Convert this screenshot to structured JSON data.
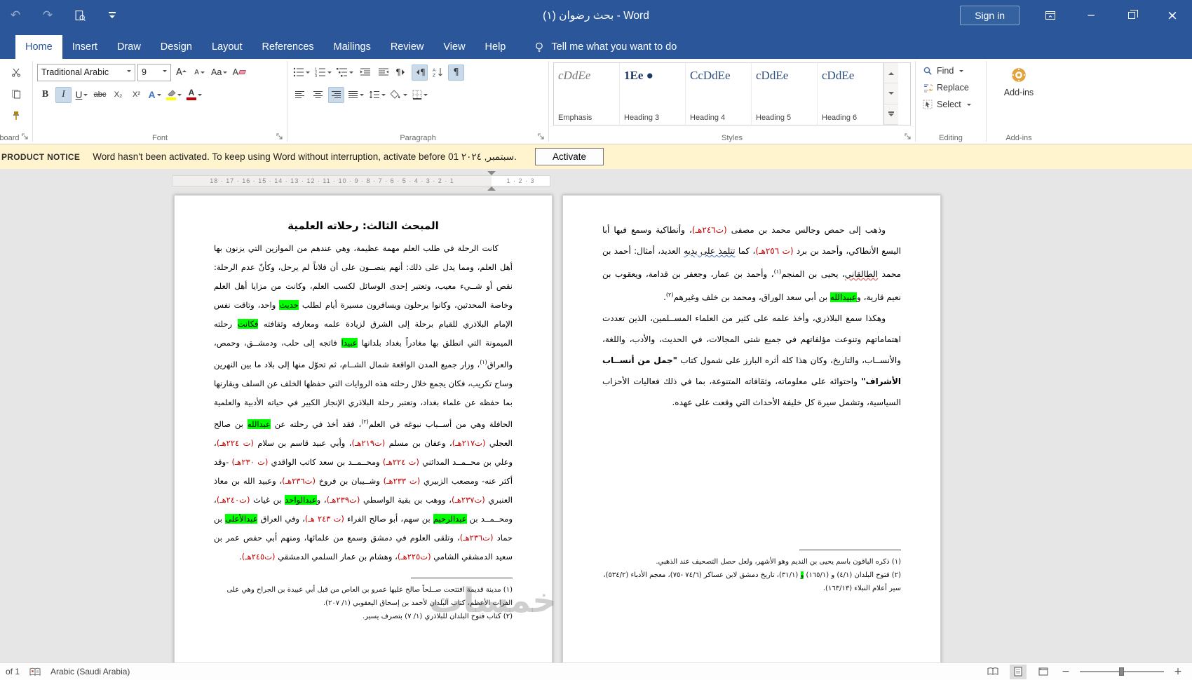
{
  "titlebar": {
    "title": "بحث رضوان (١)  -  Word",
    "sign_in": "Sign in"
  },
  "tabs": [
    {
      "label": "Home"
    },
    {
      "label": "Insert"
    },
    {
      "label": "Draw"
    },
    {
      "label": "Design"
    },
    {
      "label": "Layout"
    },
    {
      "label": "References"
    },
    {
      "label": "Mailings"
    },
    {
      "label": "Review"
    },
    {
      "label": "View"
    },
    {
      "label": "Help"
    }
  ],
  "tell_me": "Tell me what you want to do",
  "icons": {
    "undo": "↶",
    "redo": "↷",
    "minimize": "─",
    "close": "×",
    "pilcrow": "¶",
    "bold": "B",
    "italic": "I",
    "underline": "U",
    "strikethrough": "abc",
    "subscript": "X₂",
    "superscript": "X²",
    "grow_font": "A",
    "shrink_font": "A",
    "change_case": "Aa",
    "clear_formatting": "A",
    "text_effects": "A",
    "font_color": "A",
    "zoom_out": "−",
    "zoom_in": "+"
  },
  "ribbon": {
    "clipboard": {
      "group_label": "Clipboard"
    },
    "font": {
      "group_label": "Font",
      "font_name": "Traditional Arabic",
      "font_size": "9"
    },
    "paragraph": {
      "group_label": "Paragraph"
    },
    "styles": {
      "group_label": "Styles",
      "items": [
        {
          "preview": "cDdEe",
          "label": "Emphasis"
        },
        {
          "preview": "1Ee ●",
          "label": "Heading 3"
        },
        {
          "preview": "CcDdEe",
          "label": "Heading 4"
        },
        {
          "preview": "cDdEe",
          "label": "Heading 5"
        },
        {
          "preview": "cDdEe",
          "label": "Heading 6"
        }
      ]
    },
    "editing": {
      "group_label": "Editing",
      "find_label": "Find",
      "replace_label": "Replace",
      "select_label": "Select"
    },
    "addins": {
      "group_label": "Add-ins",
      "button_label": "Add-ins"
    }
  },
  "notice": {
    "label": "PRODUCT NOTICE",
    "message": "Word hasn't been activated. To keep using Word without interruption, activate before 01 سبتمبر, ٢٠٢٤.",
    "button": "Activate"
  },
  "ruler": {
    "outside_numbers": "18 · 17 · 16 · 15 · 14 · 13 · 12 · 11 · 10 · 9 · 8 · 7 · 6 · 5 · 4 · 3 · 2 · 1",
    "margin_numbers": "1 · 2 · 3"
  },
  "document": {
    "page_right": {
      "paragraphs": [
        [
          {
            "t": "وذهب إلى حمص وجالس محمد بن مصفى "
          },
          {
            "t": "(ت٢٤٦هـ)",
            "c": "red"
          },
          {
            "t": "، وأنطاكية وسمع فيها أبا اليسع الأنطاكي، وأحمد بن برد "
          },
          {
            "t": "(ت ٢٥٦هـ)",
            "c": "red"
          },
          {
            "t": "، كما "
          },
          {
            "t": "تتلمذ على يديه",
            "c": "sqb"
          },
          {
            "t": " العديد، أمثال: أحمد بن محمد "
          },
          {
            "t": "الطالقاني",
            "c": "sqr"
          },
          {
            "t": "، يحيى بن المنجم"
          },
          {
            "t": "(١)",
            "c": "sup"
          },
          {
            "t": "، وأحمد بن عمار، وجعفر بن قدامة، ويعقوب بن نعيم قارية، و"
          },
          {
            "t": "عبيدالله",
            "c": "hl"
          },
          {
            "t": " بن أبي سعد الوراق، ومحمد بن خلف وغيرهم"
          },
          {
            "t": "(٢)",
            "c": "sup"
          },
          {
            "t": "."
          }
        ],
        [
          {
            "t": "وهكذا سمع البلاذري، وأخذ علمه على كثير من العلماء المســلمين، الذين تعددت اهتماماتهم وتنوعت مؤلفاتهم في جميع شتى المجالات، في الحديث، والأدب، واللغة، والأنســاب، والتاريخ، وكان هذا كله أثره البارز على شمول كتاب "
          },
          {
            "t": "\"جمل من أنســاب الأشراف\"",
            "c": "b"
          },
          {
            "t": " واحتوائه على معلوماته، وثقافاته المتنوعة، بما في ذلك فعاليات الأحزاب السياسية، وتشمل سيرة كل خليفة الأحداث التي وقعت على عهده."
          }
        ]
      ],
      "footnotes": [
        [
          {
            "t": "(١) ذكره الباقون باسم يحيى بن النديم وهو الأشهر، ولعل حصل التصحيف عند الذهبي."
          }
        ],
        [
          {
            "t": "(٢) فتوح البلدان (٤/١) و (١٦٥/١) "
          },
          {
            "t": "و",
            "c": "hl"
          },
          {
            "t": " (٣١/١)، تاريخ دمشق لابن عساكر (٧٤/٦ -٧٥)، معجم الأدباء (٥٣٤/٢)، سير أعلام النبلاء (١٦٣/١٣)."
          }
        ]
      ]
    },
    "page_left": {
      "heading": "المبحث الثالث: رحلاته العلمية",
      "paragraphs": [
        [
          {
            "t": "كانت الرحلة في طلب العلم مهمة عظيمة، وهي عندهم من الموازين التي يزنون بها أهل العلم، ومما يدل على ذلك: أنهم ينصــون على أن فلاناً لم يرحل، وكأنّ عدم الرحلة: نقص أو شــيء معيب، وتعتبر إحدى الوسائل لكسب العلم، وكانت من مزايا أهل العلم وخاصة المحدثين، وكانوا يرحلون ويسافرون مسيرة أيام لطلب "
          },
          {
            "t": "حديث",
            "c": "hl"
          },
          {
            "t": " واحد، وتاقت نفس الإمام البلاذري للقيام برحلة إلى الشرق لزيادة علمه ومعارفه وثقافته "
          },
          {
            "t": "فكانت",
            "c": "hl"
          },
          {
            "t": " رحلته الميمونة التي انطلق بها مغادراً بغداد بلدانها "
          },
          {
            "t": "عبيدا",
            "c": "hl"
          },
          {
            "t": " فاتجه إلى حلب، ودمشــق، وحمص، والعراق"
          },
          {
            "t": "(١)",
            "c": "sup"
          },
          {
            "t": "، وزار جميع المدن الواقعة شمال الشــام، ثم تحوّل منها إلى بلاد ما بين النهرين وساح تكريب، فكان يجمع خلال رحلته هذه الروايات التي حفظها الخلف عن السلف ويقارنها بما حفظه عن علماء بغداد، وتعتبر رحلة البلاذري الإنجاز الكبير في حياته الأدبية والعلمية الحافلة وهي من أســباب نبوغه في العلم"
          },
          {
            "t": "(٢)",
            "c": "sup"
          },
          {
            "t": "، فقد أخذ في رحلته عن "
          },
          {
            "t": "عبدالله",
            "c": "hl"
          },
          {
            "t": " بن صالح العجلي "
          },
          {
            "t": "(ت٢١٧هـ)",
            "c": "red"
          },
          {
            "t": "، وعفان بن مسلم "
          },
          {
            "t": "(ت٢١٩هـ)",
            "c": "red"
          },
          {
            "t": "، وأبي عبيد قاسم بن سلام "
          },
          {
            "t": "(ت ٢٢٤هـ)",
            "c": "red"
          },
          {
            "t": "، وعلي بن محــمــد المدائني "
          },
          {
            "t": "(ت ٢٢٤هـ)",
            "c": "red"
          },
          {
            "t": " ومحــمــد بن سعد كاتب الواقدي "
          },
          {
            "t": "(ت ٢٣٠هـ)",
            "c": "red"
          },
          {
            "t": " -وقد أكثر عنه- ومصعب الزبيري "
          },
          {
            "t": "(ت ٢٣٣هـ)",
            "c": "red"
          },
          {
            "t": " وشــيبان بن فروخ "
          },
          {
            "t": "(ت٢٣٦هـ)",
            "c": "red"
          },
          {
            "t": "، وعبيد الله بن معاذ العنبري "
          },
          {
            "t": "(ت٢٣٧هـ)",
            "c": "red"
          },
          {
            "t": "، ووهب بن بقية الواسطي "
          },
          {
            "t": "(ت٢٣٩هـ)",
            "c": "red"
          },
          {
            "t": "، و"
          },
          {
            "t": "عبدالواحد",
            "c": "hl"
          },
          {
            "t": " بن غياث "
          },
          {
            "t": "(ت٢٤٠هـ)",
            "c": "red"
          },
          {
            "t": "، ومحــمــد بن "
          },
          {
            "t": "عبدالرحيم",
            "c": "hl"
          },
          {
            "t": " بن سهم، أبو صالح الفراء "
          },
          {
            "t": "(ت ٢٤٣ هـ)",
            "c": "red"
          },
          {
            "t": "، وفي العراق "
          },
          {
            "t": "عبدالأعلى",
            "c": "hl"
          },
          {
            "t": " بن حماد "
          },
          {
            "t": "(ت٢٣٦هـ)",
            "c": "red"
          },
          {
            "t": "، وتلقى العلوم في دمشق وسمع من علمائها، ومنهم أبي حفص عمر بن سعيد الدمشقي الشامي "
          },
          {
            "t": "(ت٢٢٥هـ)",
            "c": "red"
          },
          {
            "t": "، وهشام بن عمار السلمي الدمشقي "
          },
          {
            "t": "(ت٢٤٥هـ)",
            "c": "red"
          },
          {
            "t": "."
          }
        ]
      ],
      "footnotes": [
        [
          {
            "t": "(١) مدينة قديمة افتتحت صــلحاً صالح عليها عمرو بن العاص من قبل أبي عبيدة بن الجراح وهي على الفرات الأعظم، كتاب البلدان لأحمد بن إسحاق اليعقوبي (١/ ٢٠٧)."
          }
        ],
        [
          {
            "t": "(٢) كتاب فتوح البلدان للبلاذري (١/ ٧) بتصرف يسير."
          }
        ]
      ]
    }
  },
  "statusbar": {
    "page_info": "of 1",
    "language": "Arabic (Saudi Arabia)"
  },
  "watermark": "خمسات",
  "colors": {
    "accent": "#2b579a",
    "highlight_green": "#00ff00",
    "date_red": "#c00000",
    "notice_bg": "#fff4ce"
  }
}
